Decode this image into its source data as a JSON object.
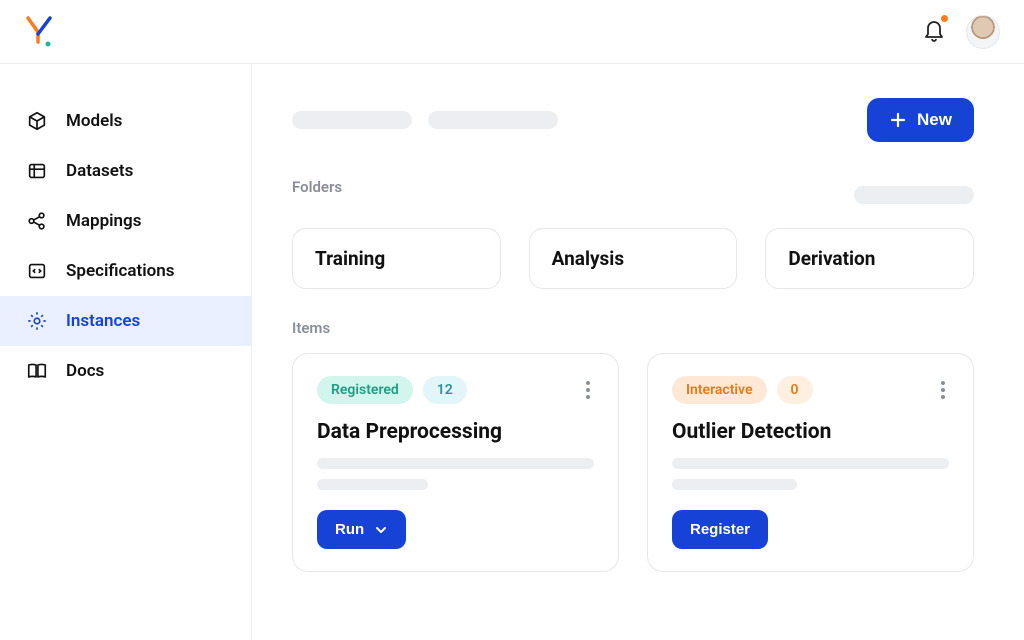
{
  "header": {
    "new_button_label": "New"
  },
  "sidebar": {
    "items": [
      {
        "label": "Models"
      },
      {
        "label": "Datasets"
      },
      {
        "label": "Mappings"
      },
      {
        "label": "Specifications"
      },
      {
        "label": "Instances"
      },
      {
        "label": "Docs"
      }
    ]
  },
  "sections": {
    "folders_label": "Folders",
    "items_label": "Items"
  },
  "folders": [
    {
      "name": "Training"
    },
    {
      "name": "Analysis"
    },
    {
      "name": "Derivation"
    }
  ],
  "items": [
    {
      "status_label": "Registered",
      "status_count": "12",
      "title": "Data Preprocessing",
      "action_label": "Run"
    },
    {
      "status_label": "Interactive",
      "status_count": "0",
      "title": "Outlier Detection",
      "action_label": "Register"
    }
  ],
  "colors": {
    "primary": "#1742d6",
    "notification_dot": "#ff7a1a"
  }
}
